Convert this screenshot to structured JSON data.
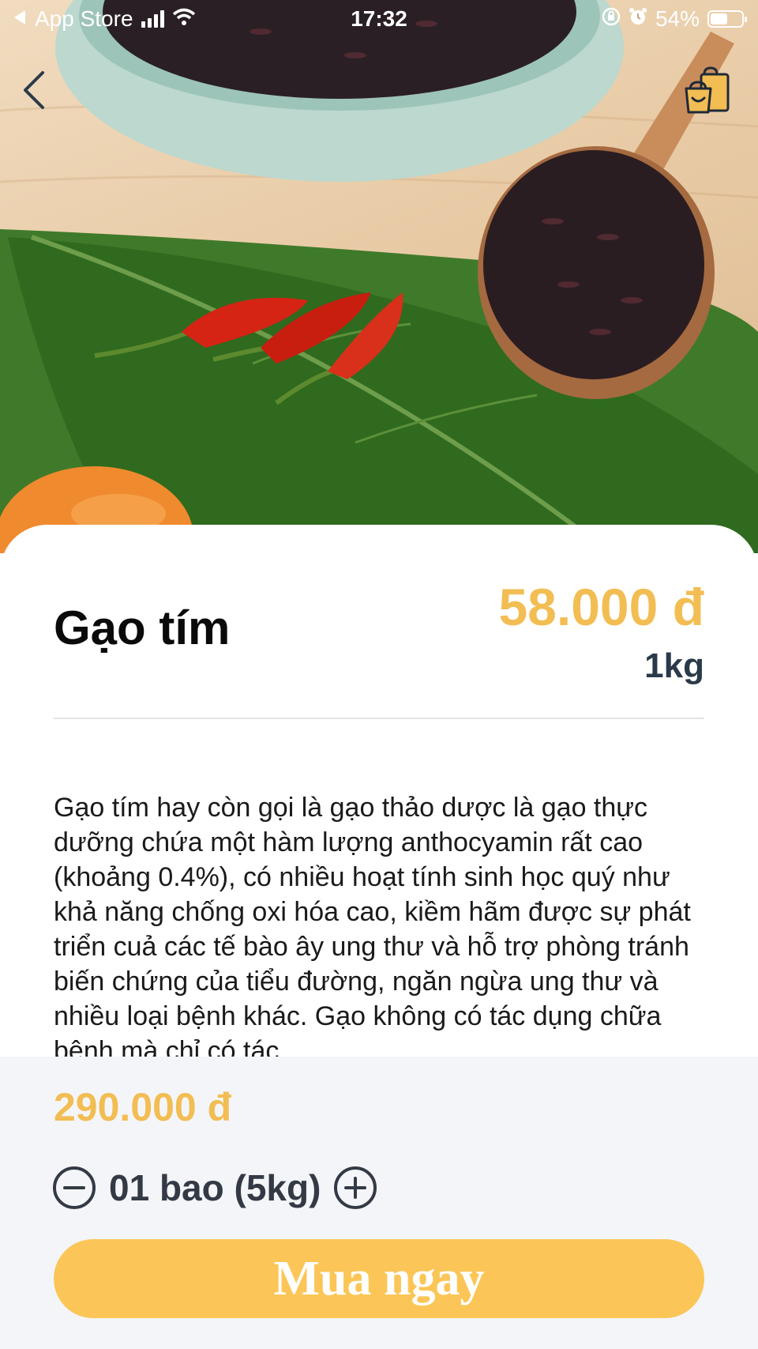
{
  "status_bar": {
    "back_app_label": "App Store",
    "time": "17:32",
    "battery_percent": "54%",
    "battery_level": 0.54,
    "icons": [
      "back-arrow-icon",
      "signal-icon",
      "wifi-icon",
      "orientation-lock-icon",
      "alarm-icon",
      "battery-icon"
    ]
  },
  "header": {
    "back_icon": "chevron-left-icon",
    "cart_icon": "shopping-bags-icon",
    "cart_icon_color": "#f2bd53"
  },
  "product": {
    "name": "Gạo tím",
    "price": "58.000 đ",
    "unit": "1kg",
    "description": "Gạo tím hay còn gọi là gạo thảo dược là gạo thực dưỡng chứa một hàm lượng anthocyamin rất cao (khoảng 0.4%), có nhiều hoạt tính sinh học quý như khả năng chống oxi hóa cao, kiềm hãm được sự phát triển cuả các tế bào ây ung thư và hỗ trợ phòng tránh biến chứng của tiểu đường, ngăn ngừa ung thư và nhiều loại bệnh khác. Gạo không có tác dụng chữa bệnh mà chỉ có tác"
  },
  "purchase": {
    "total_price": "290.000 đ",
    "quantity_label": "01 bao (5kg)",
    "minus_icon": "minus-circle-icon",
    "plus_icon": "plus-circle-icon",
    "buy_label": "Mua ngay"
  },
  "colors": {
    "accent": "#f2bd53",
    "button": "#fbc657",
    "dark_text": "#2a3a4a",
    "panel_bg": "#f4f5f9"
  }
}
